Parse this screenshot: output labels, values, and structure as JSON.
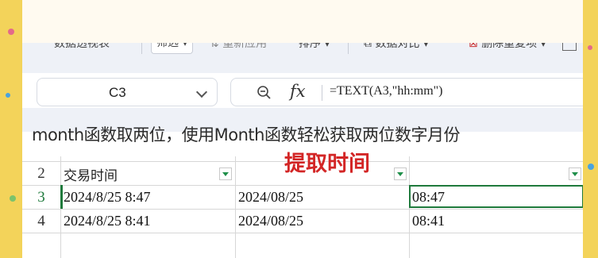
{
  "toolbar": {
    "items": [
      "数据透视表",
      "筛选",
      "重新应用",
      "排序",
      "数据对比",
      "删除重复项"
    ]
  },
  "formula_bar": {
    "cell_ref": "C3",
    "fx_label": "fx",
    "formula": "=TEXT(A3,\"hh:mm\")"
  },
  "caption": "month函数取两位，使用Month函数轻松获取两位数字月份",
  "annotation": "提取时间",
  "grid": {
    "row_numbers": [
      "2",
      "3",
      "4"
    ],
    "header": "交易时间",
    "rows": [
      {
        "a": "2024/8/25  8:47",
        "b": "2024/08/25",
        "c": "08:47"
      },
      {
        "a": "2024/8/25  8:41",
        "b": "2024/08/25",
        "c": "08:41"
      }
    ]
  },
  "colors": {
    "accent_green": "#1f7a3c",
    "annotation_red": "#d32626",
    "frame_yellow": "#f3d35a"
  }
}
